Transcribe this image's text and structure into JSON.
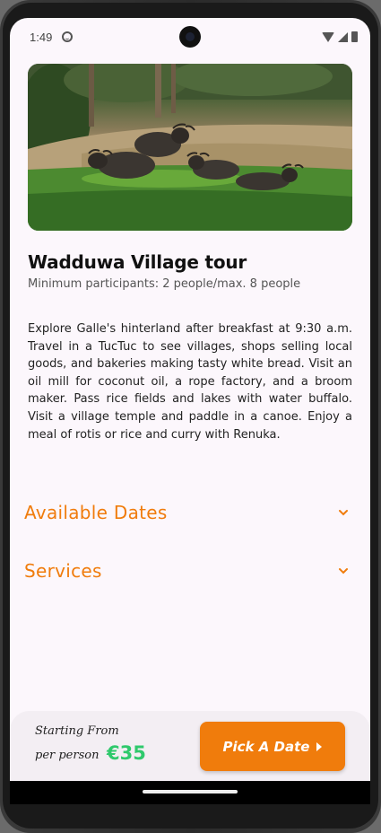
{
  "status_bar": {
    "time": "1:49"
  },
  "tour": {
    "title": "Wadduwa Village tour",
    "subtitle": "Minimum participants: 2 people/max. 8 people",
    "description": "Explore Galle's hinterland after breakfast at 9:30 a.m. Travel in a TucTuc to see villages, shops selling local goods, and bakeries making tasty white bread. Visit an oil mill for coconut oil, a rope factory, and a broom maker. Pass rice fields and lakes with water buffalo. Visit a village temple and paddle in a canoe. Enjoy a meal of rotis or rice and curry with Renuka."
  },
  "sections": [
    {
      "label": "Available Dates",
      "icon": "chevron-down-icon"
    },
    {
      "label": "Services",
      "icon": "chevron-down-icon"
    }
  ],
  "booking": {
    "starting_from": "Starting From",
    "per_person": "per person",
    "price": "€35",
    "button_label": "Pick A Date",
    "button_icon": "play-icon"
  },
  "colors": {
    "accent": "#f07c0c",
    "price": "#2fc96c",
    "background": "#fcf7fc"
  }
}
